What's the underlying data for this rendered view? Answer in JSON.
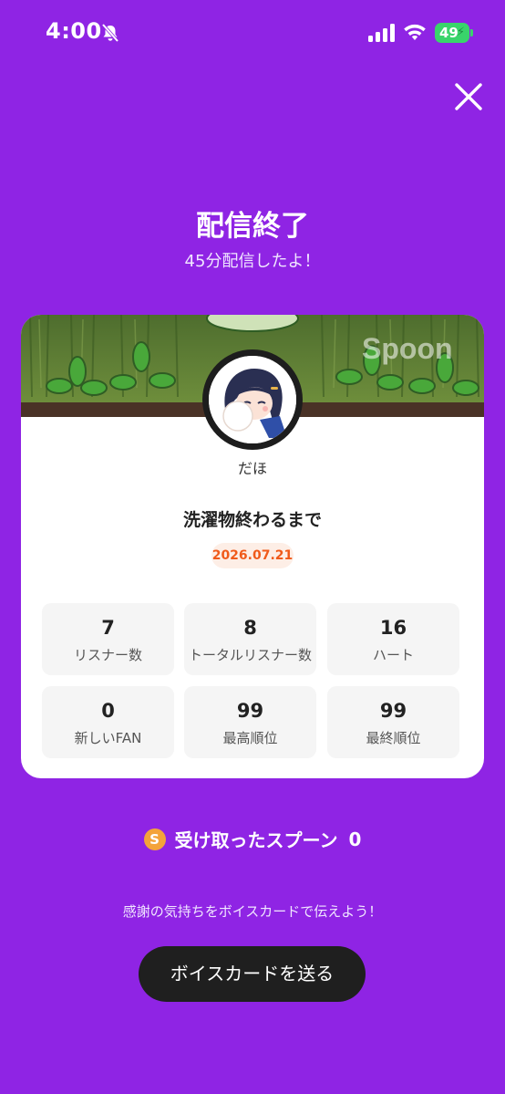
{
  "status_bar": {
    "time": "4:00",
    "battery": "49"
  },
  "header": {
    "title": "配信終了",
    "subtitle": "45分配信したよ！"
  },
  "card": {
    "banner_watermark": "Spoon",
    "username": "だほ",
    "live_title": "洗濯物終わるまで",
    "date": "2026.07.21",
    "stats": [
      {
        "value": "7",
        "label": "リスナー数"
      },
      {
        "value": "8",
        "label": "トータルリスナー数"
      },
      {
        "value": "16",
        "label": "ハート"
      },
      {
        "value": "0",
        "label": "新しいFAN"
      },
      {
        "value": "99",
        "label": "最高順位"
      },
      {
        "value": "99",
        "label": "最終順位"
      }
    ]
  },
  "spoon": {
    "coin_symbol": "S",
    "label": "受け取ったスプーン",
    "count": "0"
  },
  "footer": {
    "thanks_text": "感謝の気持ちをボイスカードで伝えよう！",
    "send_button": "ボイスカードを送る"
  },
  "colors": {
    "background": "#8f24e4",
    "date_text": "#f05a1a",
    "button": "#1f1f1f"
  }
}
